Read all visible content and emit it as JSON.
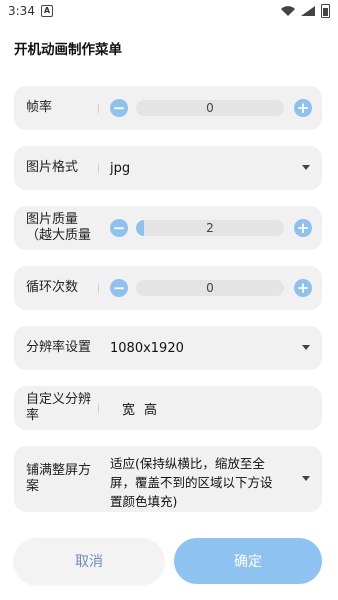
{
  "status_bar": {
    "time": "3:34",
    "app_badge": "A"
  },
  "title": "开机动画制作菜单",
  "rows": {
    "frame_rate": {
      "label": "帧率",
      "value": "0"
    },
    "image_format": {
      "label": "图片格式",
      "value": "jpg"
    },
    "image_quality": {
      "label_line1": "图片质量",
      "label_line2": "（越大质量",
      "value": "2"
    },
    "loop_count": {
      "label": "循环次数",
      "value": "0"
    },
    "resolution": {
      "label": "分辨率设置",
      "value": "1080x1920"
    },
    "custom_resolution": {
      "label_line1": "自定义分辨",
      "label_line2": "率",
      "width_placeholder": "宽",
      "height_placeholder": "高"
    },
    "fill_screen": {
      "label_line1": "铺满整屏方",
      "label_line2": "案",
      "value_line1": "适应(保持纵横比，缩放至全",
      "value_line2": "屏，覆盖不到的区域以下方设",
      "value_line3": "置颜色填充)"
    }
  },
  "buttons": {
    "cancel": "取消",
    "confirm": "确定"
  },
  "colors": {
    "accent": "#8ec3f1",
    "row_bg": "#f1f1f1"
  }
}
